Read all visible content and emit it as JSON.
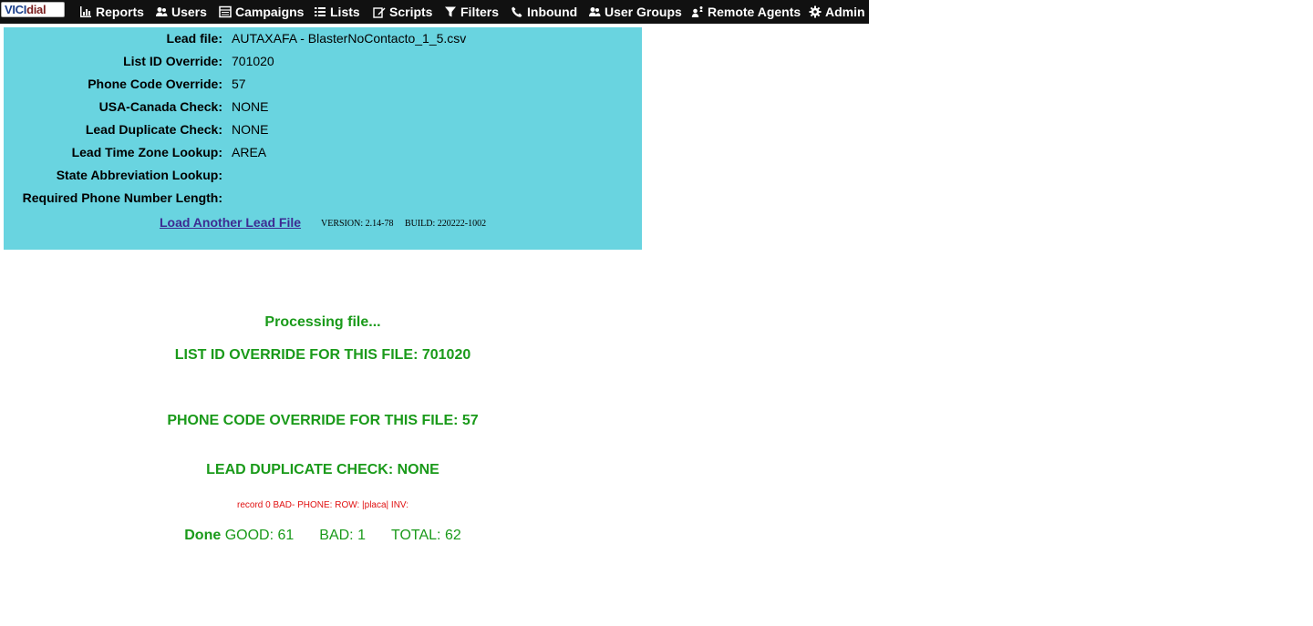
{
  "nav": {
    "logo": {
      "part1": "VICI",
      "part2": "dial"
    },
    "items": [
      {
        "label": "Reports",
        "icon": "reports-icon"
      },
      {
        "label": "Users",
        "icon": "users-icon"
      },
      {
        "label": "Campaigns",
        "icon": "campaigns-icon"
      },
      {
        "label": "Lists",
        "icon": "lists-icon"
      },
      {
        "label": "Scripts",
        "icon": "scripts-icon"
      },
      {
        "label": "Filters",
        "icon": "filter-icon"
      },
      {
        "label": "Inbound",
        "icon": "phone-icon"
      },
      {
        "label": "User Groups",
        "icon": "user-groups-icon"
      },
      {
        "label": "Remote Agents",
        "icon": "remote-agents-icon"
      },
      {
        "label": "Admin",
        "icon": "gear-icon"
      }
    ]
  },
  "panel": {
    "rows": [
      {
        "label": "Lead file:",
        "value": "AUTAXAFA - BlasterNoContacto_1_5.csv"
      },
      {
        "label": "List ID Override:",
        "value": "701020"
      },
      {
        "label": "Phone Code Override:",
        "value": "57"
      },
      {
        "label": "USA-Canada Check:",
        "value": "NONE"
      },
      {
        "label": "Lead Duplicate Check:",
        "value": "NONE"
      },
      {
        "label": "Lead Time Zone Lookup:",
        "value": "AREA"
      },
      {
        "label": "State Abbreviation Lookup:",
        "value": ""
      },
      {
        "label": "Required Phone Number Length:",
        "value": ""
      }
    ],
    "load_link": "Load Another Lead File",
    "version": "VERSION: 2.14-78",
    "build": "BUILD: 220222-1002"
  },
  "output": {
    "processing": "Processing file...",
    "list_override": "LIST ID OVERRIDE FOR THIS FILE: 701020",
    "phone_override": "PHONE CODE OVERRIDE FOR THIS FILE: 57",
    "dup_check": "LEAD DUPLICATE CHECK: NONE",
    "bad_record": "record 0 BAD- PHONE: ROW: |placa| INV:",
    "done_label": "Done",
    "good": "GOOD: 61",
    "bad": "BAD: 1",
    "total": "TOTAL: 62"
  },
  "colors": {
    "nav_bg": "#111111",
    "panel_bg": "#69d4e0",
    "status_green": "#1a9a1a",
    "error_red": "#e01010",
    "link": "#3d2b92"
  }
}
